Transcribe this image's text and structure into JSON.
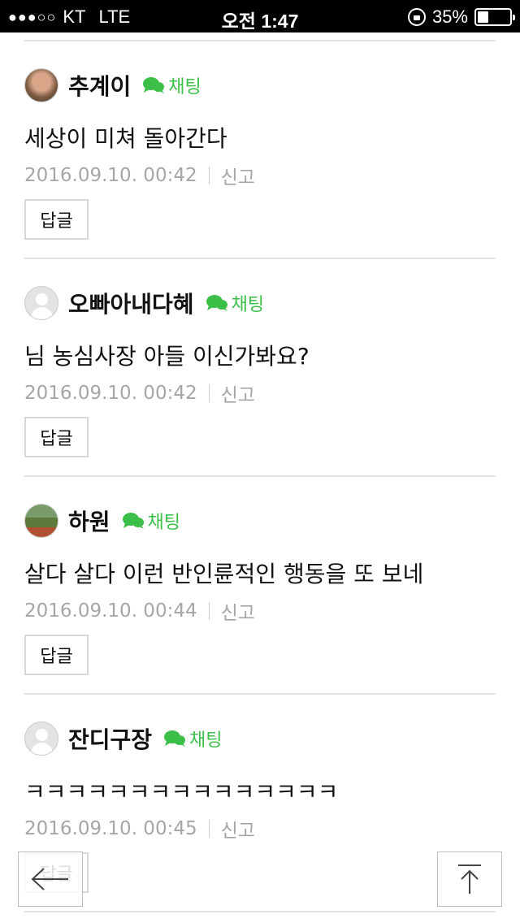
{
  "status_bar": {
    "signal_dots": "●●●○○",
    "carrier": "KT",
    "network": "LTE",
    "time": "오전 1:47",
    "battery_percent": "35%",
    "battery_level": 0.35
  },
  "comments": [
    {
      "nickname": "추계이",
      "avatar": "photo-man",
      "chat_label": "채팅",
      "text": "세상이 미쳐 돌아간다",
      "timestamp": "2016.09.10. 00:42",
      "report_label": "신고",
      "reply_label": "답글"
    },
    {
      "nickname": "오빠아내다혜",
      "avatar": "default",
      "chat_label": "채팅",
      "text": "님 농심사장 아들 이신가봐요?",
      "timestamp": "2016.09.10. 00:42",
      "report_label": "신고",
      "reply_label": "답글"
    },
    {
      "nickname": "하원",
      "avatar": "photo-field",
      "chat_label": "채팅",
      "text": "살다 살다 이런 반인륜적인 행동을 또 보네",
      "timestamp": "2016.09.10. 00:44",
      "report_label": "신고",
      "reply_label": "답글"
    },
    {
      "nickname": "잔디구장",
      "avatar": "default",
      "chat_label": "채팅",
      "text": "ㅋㅋㅋㅋㅋㅋㅋㅋㅋㅋㅋㅋㅋㅋㅋ",
      "timestamp": "2016.09.10. 00:45",
      "report_label": "신고",
      "reply_label": "답글"
    }
  ],
  "colors": {
    "chat_green": "#3cbf48",
    "meta_gray": "#a6a6a6",
    "divider": "#e3e3e3"
  },
  "icons": {
    "back": "arrow-left-icon",
    "top": "arrow-up-to-top-icon",
    "chat": "chat-bubble-icon"
  }
}
